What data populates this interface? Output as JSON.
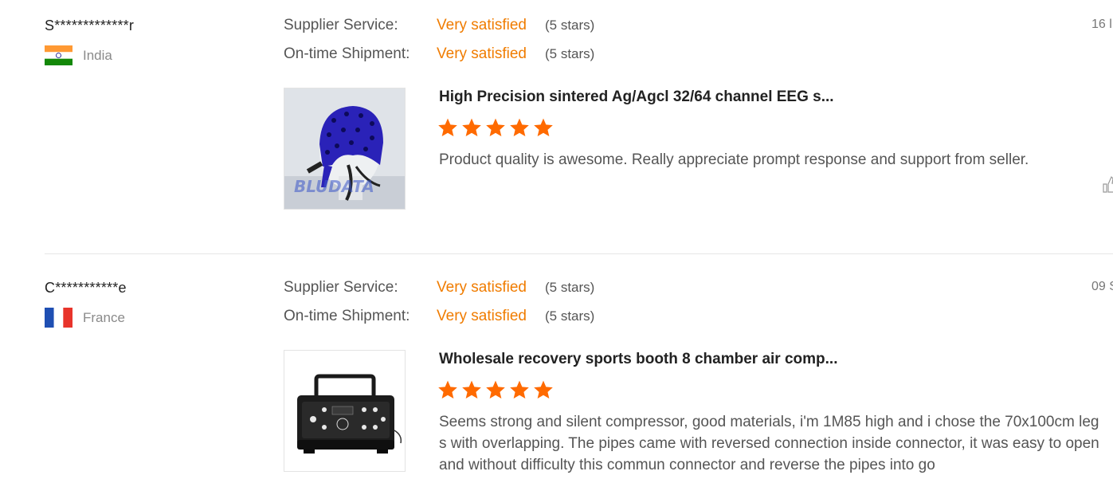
{
  "reviews": [
    {
      "buyer": "S*************r",
      "country": "India",
      "flag": "india-flag",
      "supplier_service_label": "Supplier Service:",
      "supplier_service_value": "Very satisfied",
      "supplier_service_stars": "(5 stars)",
      "shipment_label": "On-time Shipment:",
      "shipment_value": "Very satisfied",
      "shipment_stars": "(5 stars)",
      "date": "16 l",
      "product_title": "High Precision sintered Ag/Agcl 32/64 channel EEG s...",
      "rating": 5,
      "text": "Product quality is awesome. Really appreciate prompt response and support from seller.",
      "thumbnail_watermark": "BLUDATA"
    },
    {
      "buyer": "C***********e",
      "country": "France",
      "flag": "france-flag",
      "supplier_service_label": "Supplier Service:",
      "supplier_service_value": "Very satisfied",
      "supplier_service_stars": "(5 stars)",
      "shipment_label": "On-time Shipment:",
      "shipment_value": "Very satisfied",
      "shipment_stars": "(5 stars)",
      "date": "09 S",
      "product_title": "Wholesale recovery sports booth 8 chamber air comp...",
      "rating": 5,
      "text": "Seems strong and silent compressor, good materials, i'm 1M85 high and i chose the 70x100cm legs with overlapping. The pipes came with reversed connection inside connector, it was easy to open and without difficulty this commun connector and reverse the pipes into go"
    }
  ],
  "colors": {
    "accent": "#f07c00",
    "star": "#ff6a00",
    "divider": "#e6e6e6"
  }
}
